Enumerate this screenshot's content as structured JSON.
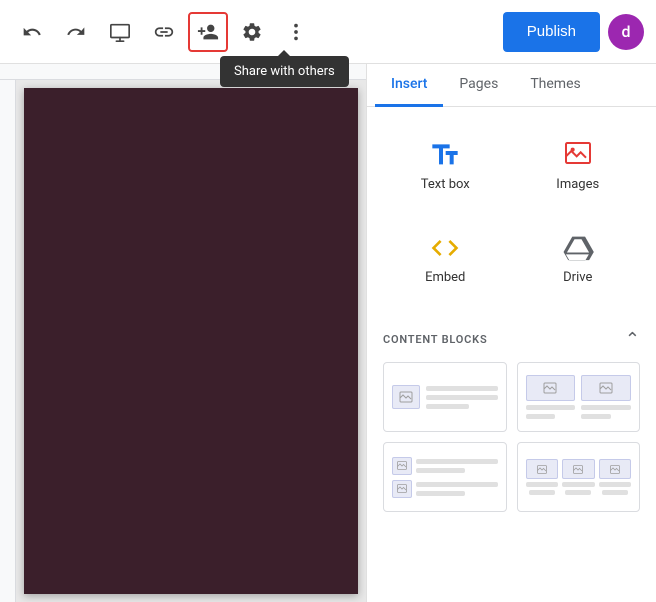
{
  "toolbar": {
    "publish_label": "Publish",
    "avatar_letter": "d",
    "tooltip_text": "Share with others"
  },
  "tabs": {
    "insert_label": "Insert",
    "pages_label": "Pages",
    "themes_label": "Themes",
    "active": "Insert"
  },
  "insert_items": [
    {
      "id": "text-box",
      "label": "Text box",
      "type": "text"
    },
    {
      "id": "images",
      "label": "Images",
      "type": "image"
    },
    {
      "id": "embed",
      "label": "Embed",
      "type": "embed"
    },
    {
      "id": "drive",
      "label": "Drive",
      "type": "drive"
    }
  ],
  "content_blocks": {
    "section_title": "CONTENT BLOCKS",
    "blocks": [
      {
        "id": "block-1",
        "type": "image-text-row"
      },
      {
        "id": "block-2",
        "type": "two-image-col"
      },
      {
        "id": "block-3",
        "type": "two-image-stacked"
      },
      {
        "id": "block-4",
        "type": "three-image-col"
      }
    ]
  }
}
